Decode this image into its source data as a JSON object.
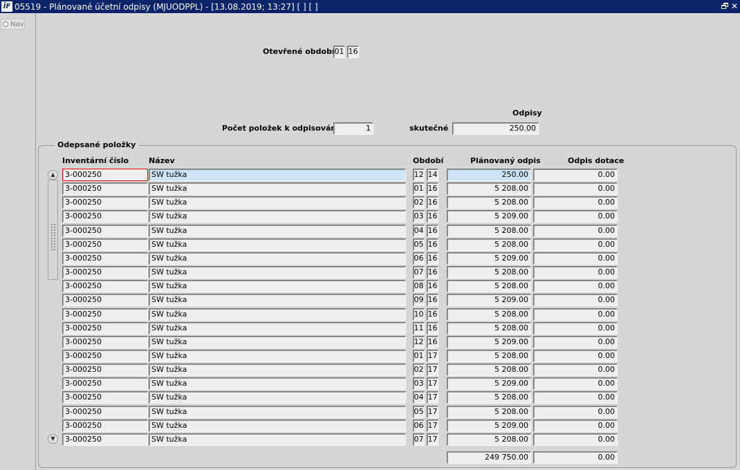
{
  "window": {
    "title": "05519 - Plánované účetní odpisy (MJUODPPL) - [13.08.2019; 13:27]  [ ]  [ ]",
    "icon_text": "ĪF"
  },
  "nav": {
    "label": "Nav"
  },
  "header": {
    "open_period_label": "Otevřené období",
    "open_period_month": "01",
    "open_period_year": "16",
    "depreciation_heading": "Odpisy",
    "item_count_label": "Počet položek k odpisování",
    "item_count_value": "1",
    "actual_label": "skutečné",
    "actual_value": "250.00"
  },
  "group": {
    "title": "Odepsané položky",
    "columns": {
      "inv": "Inventární číslo",
      "nazev": "Název",
      "obdobi": "Období",
      "planned": "Plánovaný odpis",
      "subsidy": "Odpis dotace"
    },
    "rows": [
      {
        "inv": "3-000250",
        "nazev": "SW tužka",
        "m": "12",
        "y": "14",
        "planned": "250.00",
        "subsidy": "0.00"
      },
      {
        "inv": "3-000250",
        "nazev": "SW tužka",
        "m": "01",
        "y": "16",
        "planned": "5 208.00",
        "subsidy": "0.00"
      },
      {
        "inv": "3-000250",
        "nazev": "SW tužka",
        "m": "02",
        "y": "16",
        "planned": "5 208.00",
        "subsidy": "0.00"
      },
      {
        "inv": "3-000250",
        "nazev": "SW tužka",
        "m": "03",
        "y": "16",
        "planned": "5 209.00",
        "subsidy": "0.00"
      },
      {
        "inv": "3-000250",
        "nazev": "SW tužka",
        "m": "04",
        "y": "16",
        "planned": "5 208.00",
        "subsidy": "0.00"
      },
      {
        "inv": "3-000250",
        "nazev": "SW tužka",
        "m": "05",
        "y": "16",
        "planned": "5 208.00",
        "subsidy": "0.00"
      },
      {
        "inv": "3-000250",
        "nazev": "SW tužka",
        "m": "06",
        "y": "16",
        "planned": "5 209.00",
        "subsidy": "0.00"
      },
      {
        "inv": "3-000250",
        "nazev": "SW tužka",
        "m": "07",
        "y": "16",
        "planned": "5 208.00",
        "subsidy": "0.00"
      },
      {
        "inv": "3-000250",
        "nazev": "SW tužka",
        "m": "08",
        "y": "16",
        "planned": "5 208.00",
        "subsidy": "0.00"
      },
      {
        "inv": "3-000250",
        "nazev": "SW tužka",
        "m": "09",
        "y": "16",
        "planned": "5 209.00",
        "subsidy": "0.00"
      },
      {
        "inv": "3-000250",
        "nazev": "SW tužka",
        "m": "10",
        "y": "16",
        "planned": "5 208.00",
        "subsidy": "0.00"
      },
      {
        "inv": "3-000250",
        "nazev": "SW tužka",
        "m": "11",
        "y": "16",
        "planned": "5 208.00",
        "subsidy": "0.00"
      },
      {
        "inv": "3-000250",
        "nazev": "SW tužka",
        "m": "12",
        "y": "16",
        "planned": "5 209.00",
        "subsidy": "0.00"
      },
      {
        "inv": "3-000250",
        "nazev": "SW tužka",
        "m": "01",
        "y": "17",
        "planned": "5 208.00",
        "subsidy": "0.00"
      },
      {
        "inv": "3-000250",
        "nazev": "SW tužka",
        "m": "02",
        "y": "17",
        "planned": "5 208.00",
        "subsidy": "0.00"
      },
      {
        "inv": "3-000250",
        "nazev": "SW tužka",
        "m": "03",
        "y": "17",
        "planned": "5 209.00",
        "subsidy": "0.00"
      },
      {
        "inv": "3-000250",
        "nazev": "SW tužka",
        "m": "04",
        "y": "17",
        "planned": "5 208.00",
        "subsidy": "0.00"
      },
      {
        "inv": "3-000250",
        "nazev": "SW tužka",
        "m": "05",
        "y": "17",
        "planned": "5 208.00",
        "subsidy": "0.00"
      },
      {
        "inv": "3-000250",
        "nazev": "SW tužka",
        "m": "06",
        "y": "17",
        "planned": "5 209.00",
        "subsidy": "0.00"
      },
      {
        "inv": "3-000250",
        "nazev": "SW tužka",
        "m": "07",
        "y": "17",
        "planned": "5 208.00",
        "subsidy": "0.00"
      }
    ],
    "totals": {
      "planned": "249 750.00",
      "subsidy": "0.00"
    }
  },
  "colors": {
    "titlebar": "#0a246a",
    "selected_row": "#cce4f8",
    "focus_border": "#e00000"
  }
}
